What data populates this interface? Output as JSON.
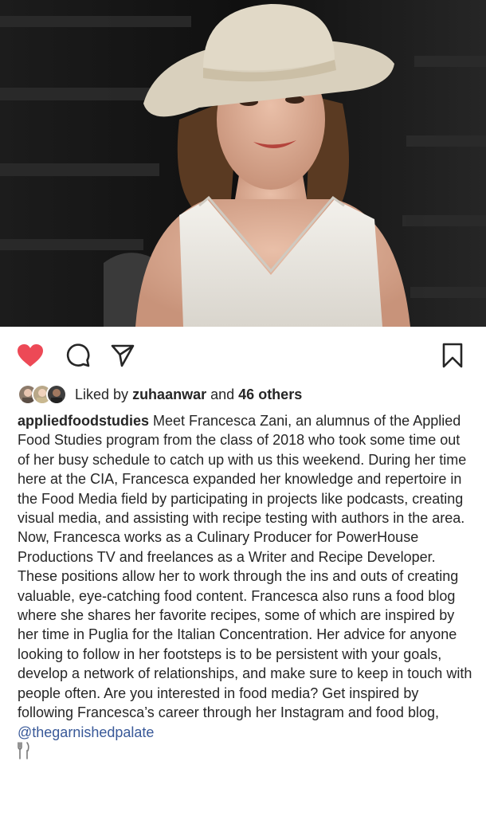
{
  "post": {
    "likes_prefix": "Liked by",
    "liked_by_user": "zuhaanwar",
    "likes_and": "and",
    "likes_others": "46 others",
    "caption_user": "appliedfoodstudies",
    "caption_text": "Meet Francesca Zani, an alumnus of the Applied Food Studies program from the class of 2018 who took some time out of her busy schedule to catch up with us this weekend. During her time here at the CIA, Francesca expanded her knowledge and repertoire in the Food Media field by participating in projects like podcasts, creating visual media, and assisting with recipe testing with authors in the area. Now, Francesca works as a Culinary Producer for PowerHouse Productions TV and freelances as a Writer and Recipe Developer. These positions allow her to work through the ins and outs of creating valuable, eye-catching food content. Francesca also runs a food blog where she shares her favorite recipes, some of which are inspired by her time in Puglia for the Italian Concentration. Her advice for anyone looking to follow in her footsteps is to be persistent with your goals, develop a network of relationships, and make sure to keep in touch with people often. Are you interested in food media? Get inspired by following Francesca’s career through her Instagram and food blog,",
    "caption_mention": "@thegarnishedpalate"
  },
  "icons": {
    "like": "heart-icon",
    "comment": "comment-icon",
    "share": "share-icon",
    "save": "bookmark-icon",
    "emoji": "fork-knife-icon"
  },
  "colors": {
    "like_active": "#ed4956",
    "text": "#262626",
    "mention": "#385898"
  }
}
